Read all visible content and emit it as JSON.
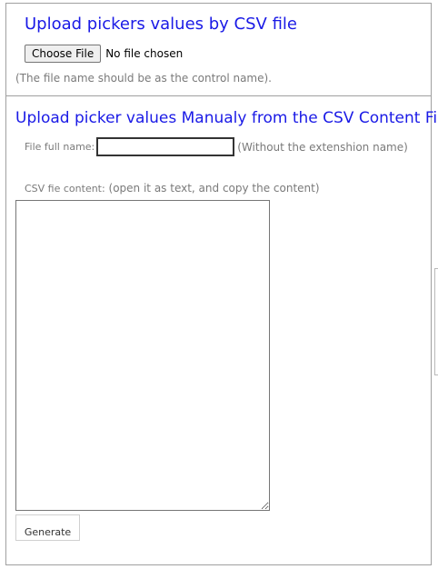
{
  "csv_upload": {
    "title": "Upload pickers values by CSV file",
    "choose_button": "Choose File",
    "no_file_text": "No file chosen",
    "note": "(The file name should be as the control name)."
  },
  "manual_upload": {
    "title": "Upload picker values Manualy from the CSV Content File",
    "file_name_label": "File full name:",
    "file_name_value": "",
    "file_name_hint": "(Without the extenshion name)",
    "csv_label_part1": "CSV fie content:",
    "csv_label_part2": " (open it as text, and copy the content)",
    "csv_content": "",
    "generate_button": "Generate"
  }
}
